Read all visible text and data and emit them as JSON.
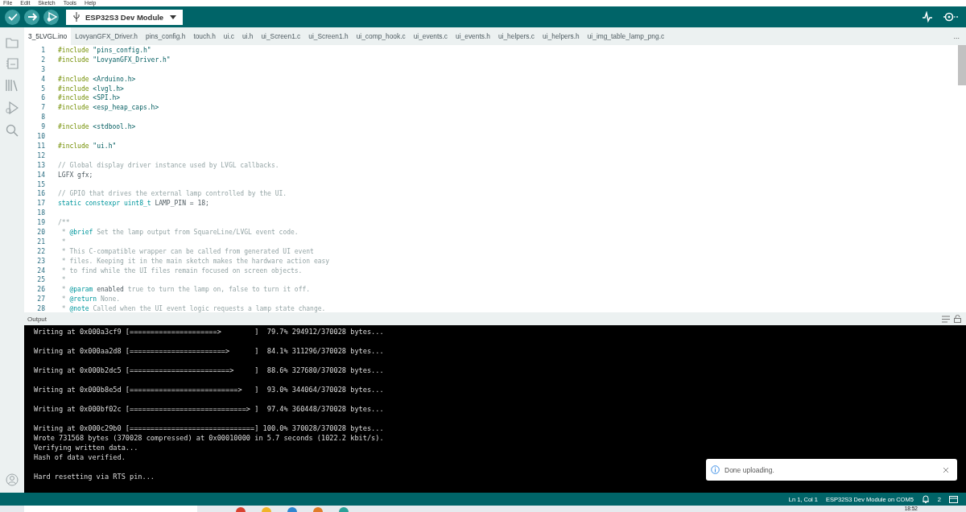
{
  "menu_bar": [
    "File",
    "Edit",
    "Sketch",
    "Tools",
    "Help"
  ],
  "toolbar": {
    "board": "ESP32S3 Dev Module"
  },
  "tabs": [
    {
      "label": "3_5LVGL.ino",
      "selected": true
    },
    {
      "label": "LovyanGFX_Driver.h",
      "selected": false
    },
    {
      "label": "pins_config.h",
      "selected": false
    },
    {
      "label": "touch.h",
      "selected": false
    },
    {
      "label": "ui.c",
      "selected": false
    },
    {
      "label": "ui.h",
      "selected": false
    },
    {
      "label": "ui_Screen1.c",
      "selected": false
    },
    {
      "label": "ui_Screen1.h",
      "selected": false
    },
    {
      "label": "ui_comp_hook.c",
      "selected": false
    },
    {
      "label": "ui_events.c",
      "selected": false
    },
    {
      "label": "ui_events.h",
      "selected": false
    },
    {
      "label": "ui_helpers.c",
      "selected": false
    },
    {
      "label": "ui_helpers.h",
      "selected": false
    },
    {
      "label": "ui_img_table_lamp_png.c",
      "selected": false
    }
  ],
  "more_tabs": "...",
  "editor": {
    "lines": [
      {
        "number": "1",
        "tokens": [
          {
            "kind": "directive",
            "text": "#include"
          },
          {
            "kind": "string",
            "text": "\"pins_config.h\""
          }
        ]
      },
      {
        "number": "2",
        "tokens": [
          {
            "kind": "directive",
            "text": "#include"
          },
          {
            "kind": "string",
            "text": "\"LovyanGFX_Driver.h\""
          }
        ]
      },
      {
        "number": "3"
      },
      {
        "number": "4",
        "tokens": [
          {
            "kind": "directive",
            "text": "#include"
          },
          {
            "kind": "string",
            "text": "<Arduino.h>"
          }
        ]
      },
      {
        "number": "5",
        "tokens": [
          {
            "kind": "directive",
            "text": "#include"
          },
          {
            "kind": "string",
            "text": "<lvgl.h>"
          }
        ]
      },
      {
        "number": "6",
        "tokens": [
          {
            "kind": "directive",
            "text": "#include"
          },
          {
            "kind": "string",
            "text": "<SPI.h>"
          }
        ]
      },
      {
        "number": "7",
        "tokens": [
          {
            "kind": "directive",
            "text": "#include"
          },
          {
            "kind": "string",
            "text": "<esp_heap_caps.h>"
          }
        ]
      },
      {
        "number": "8"
      },
      {
        "number": "9",
        "tokens": [
          {
            "kind": "directive",
            "text": "#include"
          },
          {
            "kind": "string",
            "text": "<stdbool.h>"
          }
        ]
      },
      {
        "number": "10"
      },
      {
        "number": "11",
        "tokens": [
          {
            "kind": "directive",
            "text": "#include"
          },
          {
            "kind": "string",
            "text": "\"ui.h\""
          }
        ]
      },
      {
        "number": "12"
      },
      {
        "number": "13",
        "tokens": [
          {
            "kind": "comment",
            "text": "// Global display driver instance used by LVGL callbacks."
          }
        ]
      },
      {
        "number": "14",
        "tokens": [
          {
            "kind": "plain",
            "text": "LGFX gfx;"
          }
        ]
      },
      {
        "number": "15"
      },
      {
        "number": "16",
        "tokens": [
          {
            "kind": "comment",
            "text": "// GPIO that drives the external lamp controlled by the UI."
          }
        ]
      },
      {
        "number": "17",
        "tokens": [
          {
            "kind": "keyword",
            "text": "static constexpr uint8_t"
          },
          {
            "kind": "plain",
            "text": "LAMP_PIN = 18;"
          }
        ]
      },
      {
        "number": "18"
      },
      {
        "number": "19",
        "tokens": [
          {
            "kind": "comment",
            "text": "/**"
          }
        ]
      },
      {
        "number": "20",
        "tokens": [
          {
            "kind": "comment",
            "text": " *"
          },
          {
            "kind": "doctag",
            "text": "@brief"
          },
          {
            "kind": "comment",
            "text": "Set the lamp output from SquareLine/LVGL event code."
          }
        ]
      },
      {
        "number": "21",
        "tokens": [
          {
            "kind": "comment",
            "text": " *"
          }
        ]
      },
      {
        "number": "22",
        "tokens": [
          {
            "kind": "comment",
            "text": " * This C-compatible wrapper can be called from generated UI event"
          }
        ]
      },
      {
        "number": "23",
        "tokens": [
          {
            "kind": "comment",
            "text": " * files. Keeping it in the main sketch makes the hardware action easy"
          }
        ]
      },
      {
        "number": "24",
        "tokens": [
          {
            "kind": "comment",
            "text": " * to find while the UI files remain focused on screen objects."
          }
        ]
      },
      {
        "number": "25",
        "tokens": [
          {
            "kind": "comment",
            "text": " *"
          }
        ]
      },
      {
        "number": "26",
        "tokens": [
          {
            "kind": "comment",
            "text": " *"
          },
          {
            "kind": "doctag",
            "text": "@param"
          },
          {
            "kind": "plain",
            "text": "enabled"
          },
          {
            "kind": "comment",
            "text": "true to turn the lamp on, false to turn it off."
          }
        ]
      },
      {
        "number": "27",
        "tokens": [
          {
            "kind": "comment",
            "text": " *"
          },
          {
            "kind": "doctag",
            "text": "@return"
          },
          {
            "kind": "comment",
            "text": "None."
          }
        ]
      },
      {
        "number": "28",
        "tokens": [
          {
            "kind": "comment",
            "text": " *"
          },
          {
            "kind": "doctag",
            "text": "@note"
          },
          {
            "kind": "comment",
            "text": "Called when the UI event logic requests a lamp state change."
          }
        ]
      }
    ]
  },
  "output": {
    "title": "Output",
    "paragraphs": [
      [
        "Writing at 0x000a3cf9 [=====================>        ]  79.7% 294912/370028 bytes..."
      ],
      [
        "Writing at 0x000aa2d8 [=======================>      ]  84.1% 311296/370028 bytes..."
      ],
      [
        "Writing at 0x000b2dc5 [========================>     ]  88.6% 327680/370028 bytes..."
      ],
      [
        "Writing at 0x000b8e5d [==========================>   ]  93.0% 344064/370028 bytes..."
      ],
      [
        "Writing at 0x000bf02c [============================> ]  97.4% 360448/370028 bytes..."
      ],
      [
        "Writing at 0x000c29b0 [==============================] 100.0% 370028/370028 bytes...",
        "Wrote 731568 bytes (370028 compressed) at 0x00010000 in 5.7 seconds (1022.2 kbit/s).",
        "Verifying written data...",
        "Hash of data verified."
      ],
      [
        "Hard resetting via RTS pin..."
      ]
    ]
  },
  "notification": {
    "message": "Done uploading."
  },
  "status_bar": {
    "position": "Ln 1, Col 1",
    "board_port": "ESP32S3 Dev Module on COM5",
    "notifications": "2"
  },
  "taskbar": {
    "time": "18:52"
  }
}
